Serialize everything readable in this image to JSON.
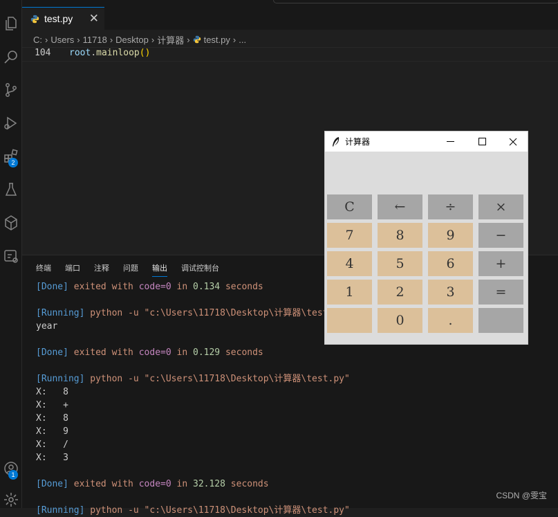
{
  "editor_tab": {
    "filename": "test.py",
    "close": "✕"
  },
  "breadcrumb": [
    "C:",
    "Users",
    "11718",
    "Desktop",
    "计算器",
    "test.py",
    "..."
  ],
  "activity_badges": {
    "extensions": "2",
    "accounts": "1"
  },
  "editor": {
    "line_number": "104",
    "code_obj": "root",
    "code_dot": ".",
    "code_fn": "mainloop",
    "code_parens": "()"
  },
  "panel": {
    "tabs": [
      "终端",
      "端口",
      "注释",
      "问题",
      "输出",
      "调试控制台"
    ],
    "active_tab": "输出"
  },
  "output": [
    {
      "tag": "[Done]",
      "pre": " exited with ",
      "kw": "code=0",
      "mid": " in ",
      "num": "0.134",
      "post": " seconds"
    },
    {
      "blank": true
    },
    {
      "tag": "[Running]",
      "cmd": " python -u \"c:\\Users\\11718\\Desktop\\计算器\\test.py\""
    },
    {
      "plain": "year"
    },
    {
      "blank": true
    },
    {
      "tag": "[Done]",
      "pre": " exited with ",
      "kw": "code=0",
      "mid": " in ",
      "num": "0.129",
      "post": " seconds"
    },
    {
      "blank": true
    },
    {
      "tag": "[Running]",
      "cmd": " python -u \"c:\\Users\\11718\\Desktop\\计算器\\test.py\""
    },
    {
      "plain": "X:   8"
    },
    {
      "plain": "X:   +"
    },
    {
      "plain": "X:   8"
    },
    {
      "plain": "X:   9"
    },
    {
      "plain": "X:   /"
    },
    {
      "plain": "X:   3"
    },
    {
      "blank": true
    },
    {
      "tag": "[Done]",
      "pre": " exited with ",
      "kw": "code=0",
      "mid": " in ",
      "num": "32.128",
      "post": " seconds"
    },
    {
      "blank": true
    },
    {
      "tag": "[Running]",
      "cmd": " python -u \"c:\\Users\\11718\\Desktop\\计算器\\test.py\""
    }
  ],
  "watermark": "CSDN @雯宝",
  "calculator": {
    "title": "计算器",
    "display": "",
    "keys": [
      [
        "C",
        "←",
        "÷",
        "×"
      ],
      [
        "7",
        "8",
        "9",
        "−"
      ],
      [
        "4",
        "5",
        "6",
        "+"
      ],
      [
        "1",
        "2",
        "3",
        "="
      ],
      [
        "",
        "0",
        ".",
        ""
      ]
    ],
    "key_kinds": [
      [
        "op",
        "op",
        "op",
        "op"
      ],
      [
        "num",
        "num",
        "num",
        "op"
      ],
      [
        "num",
        "num",
        "num",
        "op"
      ],
      [
        "num",
        "num",
        "num",
        "op"
      ],
      [
        "num",
        "num",
        "num",
        "op"
      ]
    ],
    "colors": {
      "operator": "#a6a6a6",
      "number": "#dcc09a",
      "body": "#dcdcdc"
    }
  },
  "colors": {
    "accent": "#0078d4",
    "background": "#1f1f1f"
  }
}
